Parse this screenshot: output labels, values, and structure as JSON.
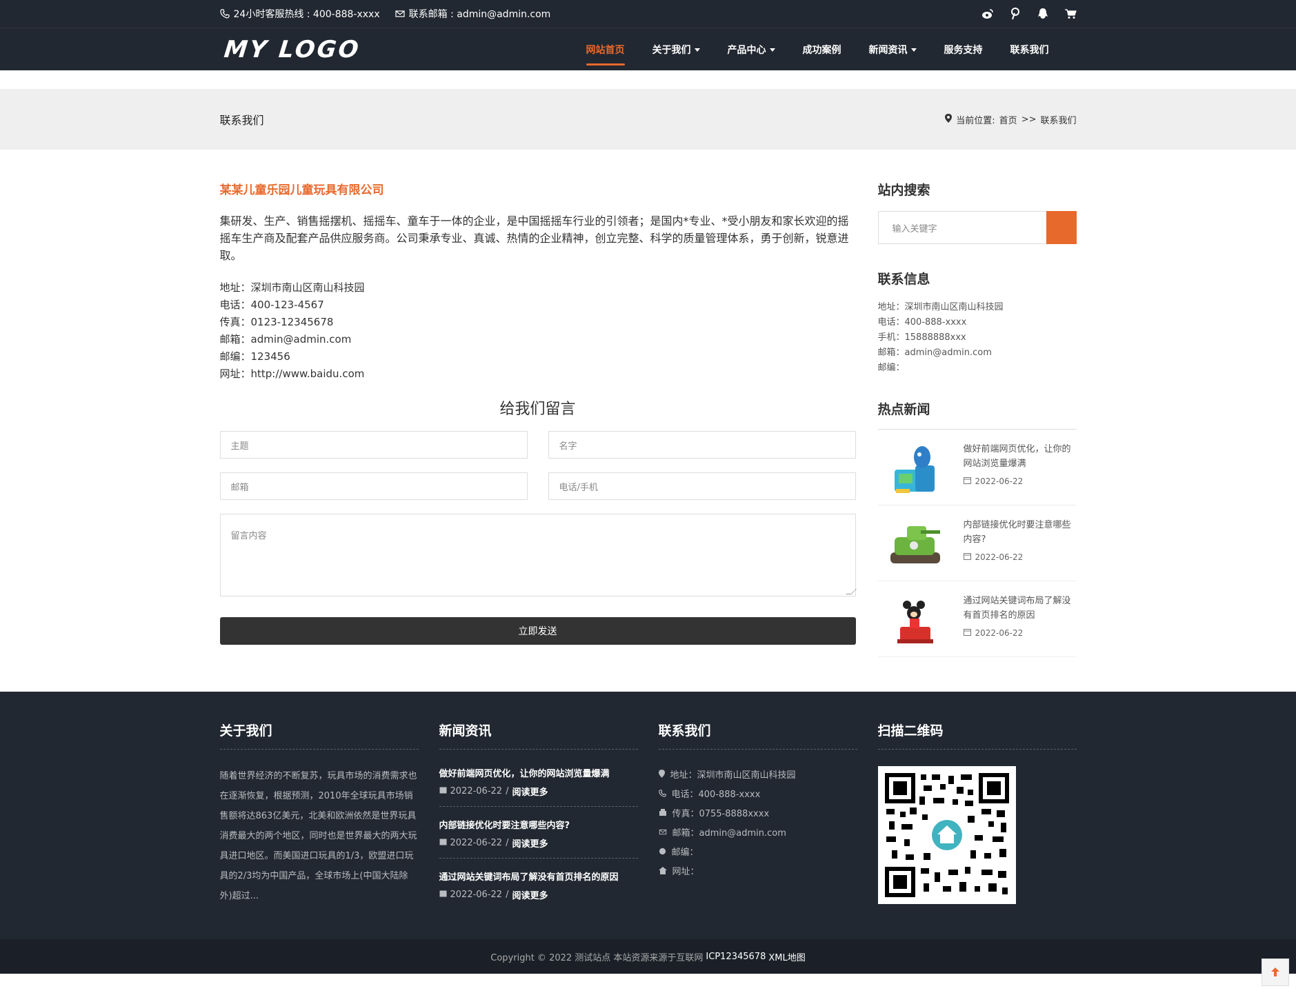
{
  "topbar": {
    "hotline": "24小时客服热线 : 400-888-xxxx",
    "email": "联系邮箱 : admin@admin.com",
    "icons": [
      "weibo-icon",
      "pinterest-icon",
      "qq-icon",
      "cart-icon"
    ]
  },
  "nav": {
    "logo": "MY LOGO",
    "items": [
      {
        "label": "网站首页",
        "active": true,
        "dropdown": false
      },
      {
        "label": "关于我们",
        "active": false,
        "dropdown": true
      },
      {
        "label": "产品中心",
        "active": false,
        "dropdown": true
      },
      {
        "label": "成功案例",
        "active": false,
        "dropdown": false
      },
      {
        "label": "新闻资讯",
        "active": false,
        "dropdown": true
      },
      {
        "label": "服务支持",
        "active": false,
        "dropdown": false
      },
      {
        "label": "联系我们",
        "active": false,
        "dropdown": false
      }
    ]
  },
  "banner": {
    "title": "联系我们",
    "crumb_prefix": "当前位置:",
    "crumb_home": "首页",
    "crumb_sep": ">>",
    "crumb_current": "联系我们"
  },
  "content": {
    "company": "某某儿童乐园儿童玩具有限公司",
    "intro": "集研发、生产、销售摇摆机、摇摇车、童车于一体的企业，是中国摇摇车行业的引领者；是国内*专业、*受小朋友和家长欢迎的摇摇车生产商及配套产品供应服务商。公司秉承专业、真诚、热情的企业精神，创立完整、科学的质量管理体系，勇于创新，锐意进取。",
    "lines": [
      "地址：深圳市南山区南山科技园",
      "电话：400-123-4567",
      "传真：0123-12345678",
      "邮箱：admin@admin.com",
      "邮编：123456",
      "网址：http://www.baidu.com"
    ],
    "form": {
      "title": "给我们留言",
      "subject": "主题",
      "name": "名字",
      "email": "邮箱",
      "phone": "电话/手机",
      "message": "留言内容",
      "submit": "立即发送"
    }
  },
  "side": {
    "search_title": "站内搜索",
    "search_placeholder": "输入关键字",
    "contact_title": "联系信息",
    "contact_lines": [
      "地址：深圳市南山区南山科技园",
      "电话：400-888-xxxx",
      "手机：15888888xxx",
      "邮箱：admin@admin.com",
      "邮编："
    ],
    "hot_title": "热点新闻",
    "hot": [
      {
        "title": "做好前端网页优化，让你的网站浏览量爆满",
        "date": "2022-06-22"
      },
      {
        "title": "内部链接优化时要注意哪些内容?",
        "date": "2022-06-22"
      },
      {
        "title": "通过网站关键词布局了解没有首页排名的原因",
        "date": "2022-06-22"
      }
    ]
  },
  "footer": {
    "about_title": "关于我们",
    "about_text": "随着世界经济的不断复苏，玩具市场的消费需求也在逐渐恢复，根据预测，2010年全球玩具市场销售额将达863亿美元，北美和欧洲依然是世界玩具消费最大的两个地区，同时也是世界最大的两大玩具进口地区。而美国进口玩具的1/3，欧盟进口玩具的2/3均为中国产品，全球市场上(中国大陆除外)超过...",
    "news_title": "新闻资讯",
    "news": [
      {
        "title": "做好前端网页优化，让你的网站浏览量爆满",
        "date": "2022-06-22",
        "sep": "/",
        "more": "阅读更多"
      },
      {
        "title": "内部链接优化时要注意哪些内容?",
        "date": "2022-06-22",
        "sep": "/",
        "more": "阅读更多"
      },
      {
        "title": "通过网站关键词布局了解没有首页排名的原因",
        "date": "2022-06-22",
        "sep": "/",
        "more": "阅读更多"
      }
    ],
    "contact_title": "联系我们",
    "contact": [
      {
        "icon": "map-marker-icon",
        "text": "地址：深圳市南山区南山科技园"
      },
      {
        "icon": "phone-icon",
        "text": "电话：400-888-xxxx"
      },
      {
        "icon": "fax-icon",
        "text": "传真：0755-8888xxxx"
      },
      {
        "icon": "envelope-icon",
        "text": "邮箱：admin@admin.com"
      },
      {
        "icon": "globe-icon",
        "text": "邮编："
      },
      {
        "icon": "home-icon",
        "text": "网址："
      }
    ],
    "qr_title": "扫描二维码",
    "copyright": "Copyright © 2022 测试站点 本站资源来源于互联网",
    "icp": "ICP12345678",
    "xml": "XML地图"
  },
  "colors": {
    "accent": "#e8692c",
    "dark": "#222831",
    "banner": "#efefef"
  }
}
